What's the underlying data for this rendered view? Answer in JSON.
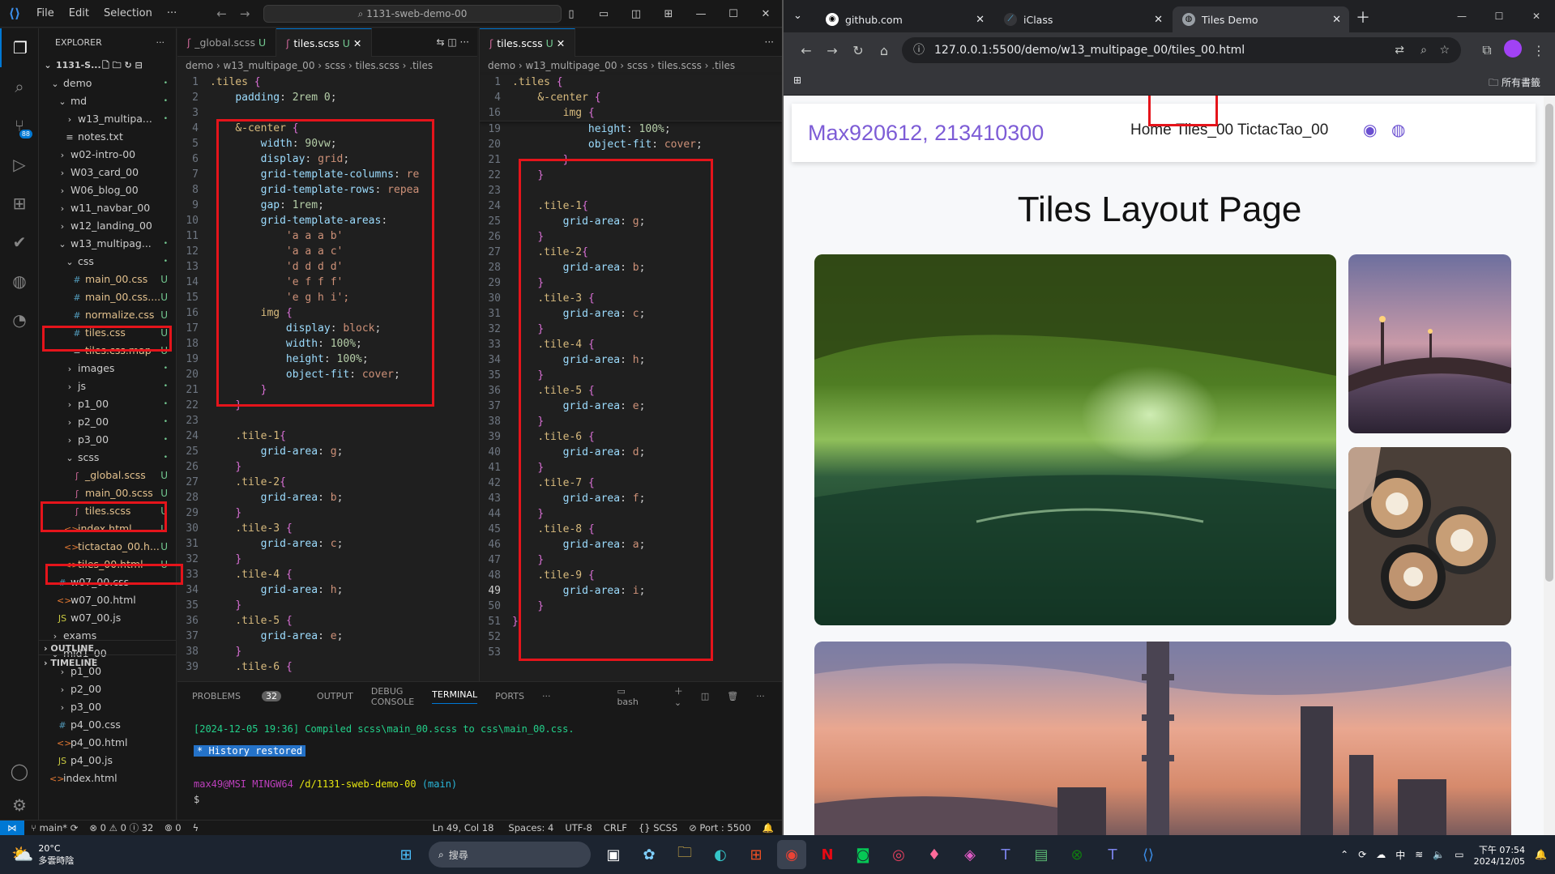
{
  "vscode": {
    "menu": [
      "File",
      "Edit",
      "Selection",
      "···"
    ],
    "command_center": "1131-sweb-demo-00",
    "explorer": {
      "title": "EXPLORER",
      "root": "1131-S...",
      "items": [
        {
          "label": "demo",
          "indent": 1,
          "type": "folder-open",
          "status": "•"
        },
        {
          "label": "md",
          "indent": 2,
          "type": "folder-open",
          "status": "•"
        },
        {
          "label": "w13_multipa...",
          "indent": 3,
          "type": "folder",
          "status": "•"
        },
        {
          "label": "notes.txt",
          "indent": 3,
          "type": "file",
          "status": ""
        },
        {
          "label": "w02-intro-00",
          "indent": 2,
          "type": "folder",
          "status": ""
        },
        {
          "label": "W03_card_00",
          "indent": 2,
          "type": "folder",
          "status": ""
        },
        {
          "label": "W06_blog_00",
          "indent": 2,
          "type": "folder",
          "status": ""
        },
        {
          "label": "w11_navbar_00",
          "indent": 2,
          "type": "folder",
          "status": ""
        },
        {
          "label": "w12_landing_00",
          "indent": 2,
          "type": "folder",
          "status": ""
        },
        {
          "label": "w13_multipag...",
          "indent": 2,
          "type": "folder-open",
          "status": "•"
        },
        {
          "label": "css",
          "indent": 3,
          "type": "folder-open",
          "status": "•"
        },
        {
          "label": "main_00.css",
          "indent": 4,
          "type": "css",
          "status": "U"
        },
        {
          "label": "main_00.css....",
          "indent": 4,
          "type": "css",
          "status": "U"
        },
        {
          "label": "normalize.css",
          "indent": 4,
          "type": "css",
          "status": "U"
        },
        {
          "label": "tiles.css",
          "indent": 4,
          "type": "css",
          "status": "U"
        },
        {
          "label": "tiles.css.map",
          "indent": 4,
          "type": "file",
          "status": "U"
        },
        {
          "label": "images",
          "indent": 3,
          "type": "folder",
          "status": "•"
        },
        {
          "label": "js",
          "indent": 3,
          "type": "folder",
          "status": "•"
        },
        {
          "label": "p1_00",
          "indent": 3,
          "type": "folder",
          "status": "•"
        },
        {
          "label": "p2_00",
          "indent": 3,
          "type": "folder",
          "status": "•"
        },
        {
          "label": "p3_00",
          "indent": 3,
          "type": "folder",
          "status": "•"
        },
        {
          "label": "scss",
          "indent": 3,
          "type": "folder-open",
          "status": "•"
        },
        {
          "label": "_global.scss",
          "indent": 4,
          "type": "scss",
          "status": "U"
        },
        {
          "label": "main_00.scss",
          "indent": 4,
          "type": "scss",
          "status": "U"
        },
        {
          "label": "tiles.scss",
          "indent": 4,
          "type": "scss",
          "status": "U"
        },
        {
          "label": "index.html",
          "indent": 3,
          "type": "html",
          "status": "U"
        },
        {
          "label": "tictactao_00.h...",
          "indent": 3,
          "type": "html",
          "status": "U"
        },
        {
          "label": "tiles_00.html",
          "indent": 3,
          "type": "html",
          "status": "U"
        },
        {
          "label": "w07_00.css",
          "indent": 2,
          "type": "css",
          "status": ""
        },
        {
          "label": "w07_00.html",
          "indent": 2,
          "type": "html",
          "status": ""
        },
        {
          "label": "w07_00.js",
          "indent": 2,
          "type": "js",
          "status": ""
        },
        {
          "label": "exams",
          "indent": 1,
          "type": "folder",
          "status": ""
        },
        {
          "label": "mid1_00",
          "indent": 1,
          "type": "folder-open",
          "status": ""
        },
        {
          "label": "p1_00",
          "indent": 2,
          "type": "folder",
          "status": ""
        },
        {
          "label": "p2_00",
          "indent": 2,
          "type": "folder",
          "status": ""
        },
        {
          "label": "p3_00",
          "indent": 2,
          "type": "folder",
          "status": ""
        },
        {
          "label": "p4_00.css",
          "indent": 2,
          "type": "css",
          "status": ""
        },
        {
          "label": "p4_00.html",
          "indent": 2,
          "type": "html",
          "status": ""
        },
        {
          "label": "p4_00.js",
          "indent": 2,
          "type": "js",
          "status": ""
        },
        {
          "label": "index.html",
          "indent": 1,
          "type": "html",
          "status": ""
        }
      ],
      "outline": "OUTLINE",
      "timeline": "TIMELINE"
    },
    "editor_left": {
      "tabs": [
        {
          "label": "_global.scss",
          "status": "U",
          "active": false
        },
        {
          "label": "tiles.scss",
          "status": "U",
          "active": true
        }
      ],
      "breadcrumb": "demo › w13_multipage_00 › scss › tiles.scss › .tiles",
      "lines": [
        {
          "n": "1",
          "t": ".tiles {"
        },
        {
          "n": "2",
          "t": "    padding: 2rem 0;"
        },
        {
          "n": "3",
          "t": ""
        },
        {
          "n": "4",
          "t": "    &-center {"
        },
        {
          "n": "5",
          "t": "        width: 90vw;"
        },
        {
          "n": "6",
          "t": "        display: grid;"
        },
        {
          "n": "7",
          "t": "        grid-template-columns: re"
        },
        {
          "n": "8",
          "t": "        grid-template-rows: repea"
        },
        {
          "n": "9",
          "t": "        gap: 1rem;"
        },
        {
          "n": "10",
          "t": "        grid-template-areas:"
        },
        {
          "n": "11",
          "t": "            'a a a b'"
        },
        {
          "n": "12",
          "t": "            'a a a c'"
        },
        {
          "n": "13",
          "t": "            'd d d d'"
        },
        {
          "n": "14",
          "t": "            'e f f f'"
        },
        {
          "n": "15",
          "t": "            'e g h i';"
        },
        {
          "n": "16",
          "t": "        img {"
        },
        {
          "n": "17",
          "t": "            display: block;"
        },
        {
          "n": "18",
          "t": "            width: 100%;"
        },
        {
          "n": "19",
          "t": "            height: 100%;"
        },
        {
          "n": "20",
          "t": "            object-fit: cover;"
        },
        {
          "n": "21",
          "t": "        }"
        },
        {
          "n": "22",
          "t": "    }"
        },
        {
          "n": "23",
          "t": ""
        },
        {
          "n": "24",
          "t": "    .tile-1{"
        },
        {
          "n": "25",
          "t": "        grid-area: g;"
        },
        {
          "n": "26",
          "t": "    }"
        },
        {
          "n": "27",
          "t": "    .tile-2{"
        },
        {
          "n": "28",
          "t": "        grid-area: b;"
        },
        {
          "n": "29",
          "t": "    }"
        },
        {
          "n": "30",
          "t": "    .tile-3 {"
        },
        {
          "n": "31",
          "t": "        grid-area: c;"
        },
        {
          "n": "32",
          "t": "    }"
        },
        {
          "n": "33",
          "t": "    .tile-4 {"
        },
        {
          "n": "34",
          "t": "        grid-area: h;"
        },
        {
          "n": "35",
          "t": "    }"
        },
        {
          "n": "36",
          "t": "    .tile-5 {"
        },
        {
          "n": "37",
          "t": "        grid-area: e;"
        },
        {
          "n": "38",
          "t": "    }"
        },
        {
          "n": "39",
          "t": "    .tile-6 {"
        }
      ]
    },
    "editor_right": {
      "tabs": [
        {
          "label": "tiles.scss",
          "status": "U",
          "active": true
        }
      ],
      "breadcrumb": "demo › w13_multipage_00 › scss › tiles.scss › .tiles",
      "sticky": [
        {
          "n": "1",
          "t": ".tiles {"
        },
        {
          "n": "4",
          "t": "    &-center {"
        },
        {
          "n": "16",
          "t": "        img {"
        }
      ],
      "lines": [
        {
          "n": "19",
          "t": "            height: 100%;"
        },
        {
          "n": "20",
          "t": "            object-fit: cover;"
        },
        {
          "n": "21",
          "t": "        }"
        },
        {
          "n": "22",
          "t": "    }"
        },
        {
          "n": "23",
          "t": ""
        },
        {
          "n": "24",
          "t": "    .tile-1{"
        },
        {
          "n": "25",
          "t": "        grid-area: g;"
        },
        {
          "n": "26",
          "t": "    }"
        },
        {
          "n": "27",
          "t": "    .tile-2{"
        },
        {
          "n": "28",
          "t": "        grid-area: b;"
        },
        {
          "n": "29",
          "t": "    }"
        },
        {
          "n": "30",
          "t": "    .tile-3 {"
        },
        {
          "n": "31",
          "t": "        grid-area: c;"
        },
        {
          "n": "32",
          "t": "    }"
        },
        {
          "n": "33",
          "t": "    .tile-4 {"
        },
        {
          "n": "34",
          "t": "        grid-area: h;"
        },
        {
          "n": "35",
          "t": "    }"
        },
        {
          "n": "36",
          "t": "    .tile-5 {"
        },
        {
          "n": "37",
          "t": "        grid-area: e;"
        },
        {
          "n": "38",
          "t": "    }"
        },
        {
          "n": "39",
          "t": "    .tile-6 {"
        },
        {
          "n": "40",
          "t": "        grid-area: d;"
        },
        {
          "n": "41",
          "t": "    }"
        },
        {
          "n": "42",
          "t": "    .tile-7 {"
        },
        {
          "n": "43",
          "t": "        grid-area: f;"
        },
        {
          "n": "44",
          "t": "    }"
        },
        {
          "n": "45",
          "t": "    .tile-8 {"
        },
        {
          "n": "46",
          "t": "        grid-area: a;"
        },
        {
          "n": "47",
          "t": "    }"
        },
        {
          "n": "48",
          "t": "    .tile-9 {"
        },
        {
          "n": "49",
          "t": "        grid-area: i;"
        },
        {
          "n": "50",
          "t": "    }"
        },
        {
          "n": "51",
          "t": "}"
        },
        {
          "n": "52",
          "t": ""
        },
        {
          "n": "53",
          "t": ""
        }
      ],
      "current_line": "49"
    },
    "panel": {
      "tabs": [
        "PROBLEMS",
        "OUTPUT",
        "DEBUG CONSOLE",
        "TERMINAL",
        "PORTS",
        "···"
      ],
      "problems_count": "32",
      "active_tab": "TERMINAL",
      "shell": "bash",
      "terminal_lines": [
        "[2024-12-05 19:36] Compiled scss\\main_00.scss to css\\main_00.css.",
        "History restored",
        "max49@MSI MINGW64 /d/1131-sweb-demo-00 (main)",
        "$"
      ],
      "prompt_user": "max49@MSI",
      "prompt_env": "MINGW64",
      "prompt_path": "/d/1131-sweb-demo-00",
      "prompt_branch": "(main)"
    },
    "status": {
      "branch": "main*",
      "errors": "0",
      "warnings": "0",
      "info": "32",
      "ports": "0",
      "position": "Ln 49, Col 18",
      "spaces": "Spaces: 4",
      "encoding": "UTF-8",
      "eol": "CRLF",
      "language": "SCSS",
      "port": "Port : 5500"
    }
  },
  "browser": {
    "tabs": [
      {
        "label": "github.com",
        "active": false
      },
      {
        "label": "iClass",
        "active": false
      },
      {
        "label": "Tiles Demo",
        "active": true
      }
    ],
    "url": "127.0.0.1:5500/demo/w13_multipage_00/tiles_00.html",
    "bookmarks_label": "所有書籤",
    "page": {
      "brand": "Max920612, 213410300",
      "nav": [
        "Home",
        "Tiles_00",
        "TictacTao_00"
      ],
      "title": "Tiles Layout Page"
    }
  },
  "taskbar": {
    "weather_temp": "20°C",
    "weather_desc": "多雲時陰",
    "search_label": "搜尋",
    "time": "下午 07:54",
    "date": "2024/12/05",
    "ime": "中"
  }
}
